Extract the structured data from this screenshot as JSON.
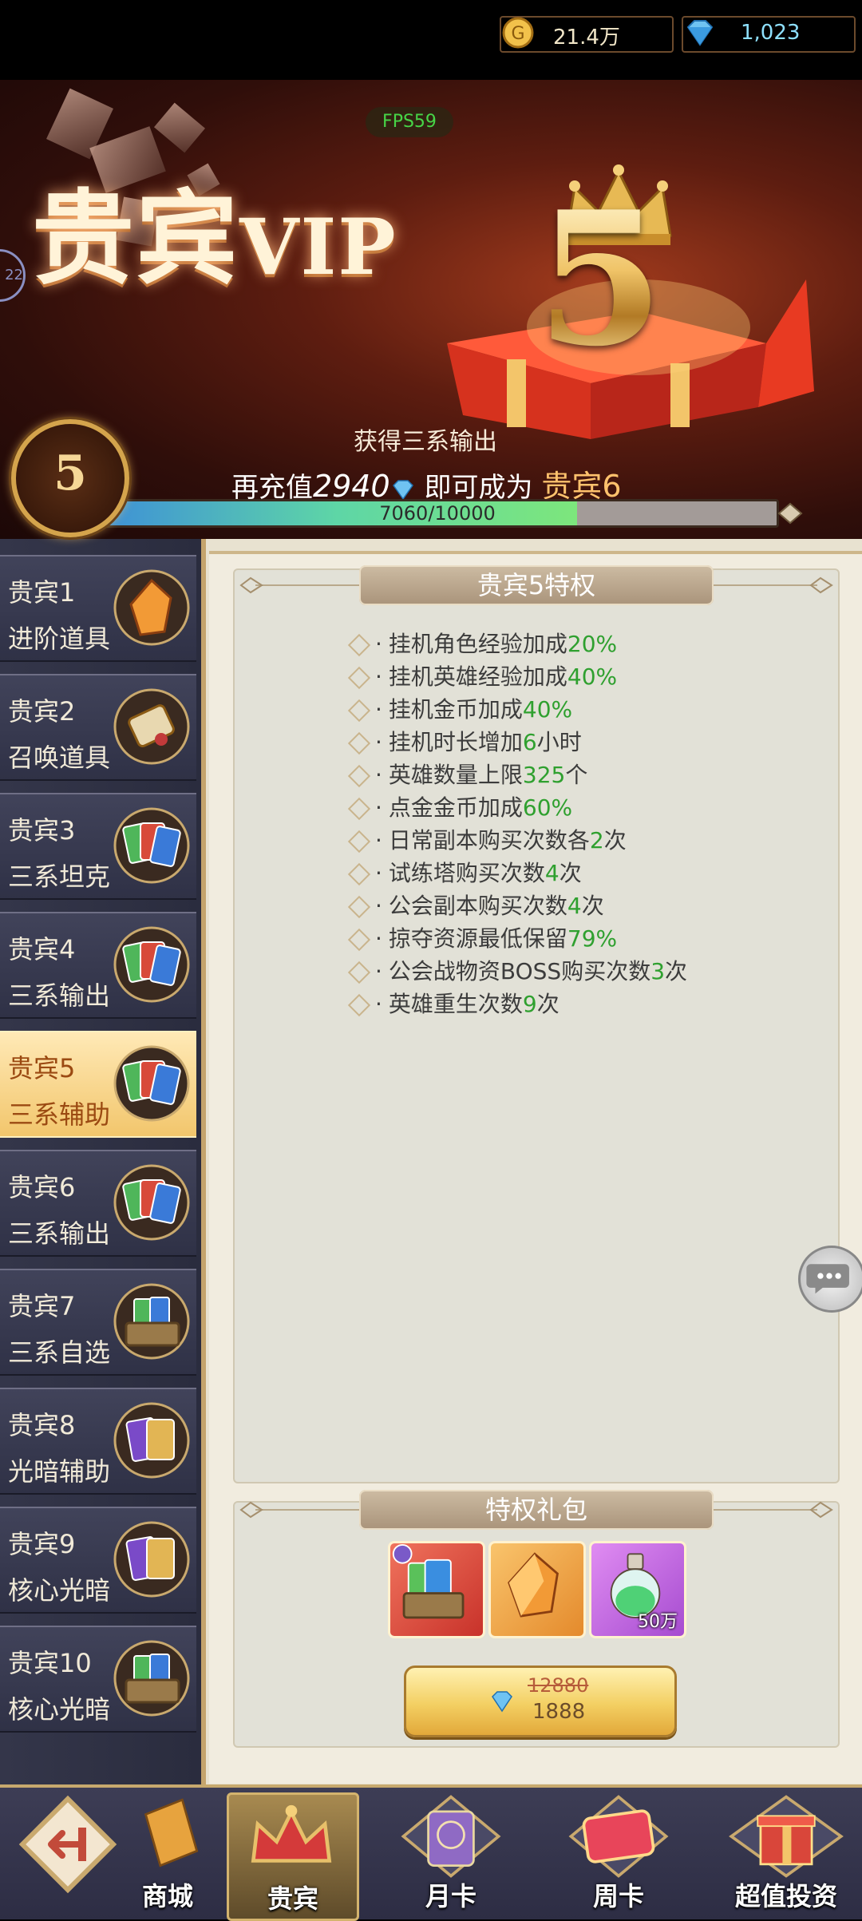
{
  "currency": {
    "gold": "21.4万",
    "diamonds": "1,023"
  },
  "banner": {
    "fps": "FPS59",
    "title_cn": "贵宾",
    "title_vip": "VIP",
    "level_art": "5",
    "reward_text": "获得三系输出",
    "badge_level": "5",
    "recharge_prefix": "再充值",
    "recharge_amount": "2940",
    "recharge_mid": "即可成为",
    "next_level": "贵宾6",
    "progress_text": "7060/10000",
    "progress_fraction": 0.706,
    "side_tag": "22"
  },
  "sidebar": {
    "items": [
      {
        "l1": "贵宾1",
        "l2": "进阶道具",
        "icon": "orange-crystal-icon"
      },
      {
        "l1": "贵宾2",
        "l2": "召唤道具",
        "icon": "summon-scroll-icon"
      },
      {
        "l1": "贵宾3",
        "l2": "三系坦克",
        "icon": "tri-cards-icon"
      },
      {
        "l1": "贵宾4",
        "l2": "三系输出",
        "icon": "tri-cards-icon"
      },
      {
        "l1": "贵宾5",
        "l2": "三系辅助",
        "icon": "tri-cards-icon"
      },
      {
        "l1": "贵宾6",
        "l2": "三系输出",
        "icon": "tri-cards-icon"
      },
      {
        "l1": "贵宾7",
        "l2": "三系自选",
        "icon": "card-chest-icon"
      },
      {
        "l1": "贵宾8",
        "l2": "光暗辅助",
        "icon": "light-dark-cards-icon"
      },
      {
        "l1": "贵宾9",
        "l2": "核心光暗",
        "icon": "light-dark-cards-icon"
      },
      {
        "l1": "贵宾10",
        "l2": "核心光暗",
        "icon": "card-chest-icon"
      }
    ],
    "active_index": 4
  },
  "privileges": {
    "title": "贵宾5特权",
    "items": [
      {
        "text": "挂机角色经验加成",
        "value": "20%",
        "suffix": ""
      },
      {
        "text": "挂机英雄经验加成",
        "value": "40%",
        "suffix": ""
      },
      {
        "text": "挂机金币加成",
        "value": "40%",
        "suffix": ""
      },
      {
        "text": "挂机时长增加",
        "value": "6",
        "suffix": "小时"
      },
      {
        "text": "英雄数量上限",
        "value": "325",
        "suffix": "个"
      },
      {
        "text": "点金金币加成",
        "value": "60%",
        "suffix": ""
      },
      {
        "text": "日常副本购买次数各",
        "value": "2",
        "suffix": "次"
      },
      {
        "text": "试练塔购买次数",
        "value": "4",
        "suffix": "次"
      },
      {
        "text": "公会副本购买次数",
        "value": "4",
        "suffix": "次"
      },
      {
        "text": "掠夺资源最低保留",
        "value": "79%",
        "suffix": ""
      },
      {
        "text": "公会战物资BOSS购买次数",
        "value": "3",
        "suffix": "次"
      },
      {
        "text": "英雄重生次数",
        "value": "9",
        "suffix": "次"
      }
    ]
  },
  "gift_pack": {
    "title": "特权礼包",
    "items": [
      {
        "icon": "card-chest-icon",
        "count": ""
      },
      {
        "icon": "orange-crystal-icon",
        "count": ""
      },
      {
        "icon": "green-potion-icon",
        "count": "50万"
      }
    ],
    "original_price": "12880",
    "price": "1888"
  },
  "bottom_nav": [
    {
      "label": "",
      "icon": "exit-icon"
    },
    {
      "label": "商城",
      "icon": "shop-icon"
    },
    {
      "label": "贵宾",
      "icon": "crown-icon",
      "active": true
    },
    {
      "label": "月卡",
      "icon": "month-card-icon"
    },
    {
      "label": "周卡",
      "icon": "week-card-icon"
    },
    {
      "label": "超值投资",
      "icon": "gift-box-icon"
    }
  ],
  "colors": {
    "accent_gold": "#d4a44c",
    "highlight_green": "#2fa02f",
    "sidebar_bg": "#34364a",
    "active_tab": "#f2c66c"
  }
}
